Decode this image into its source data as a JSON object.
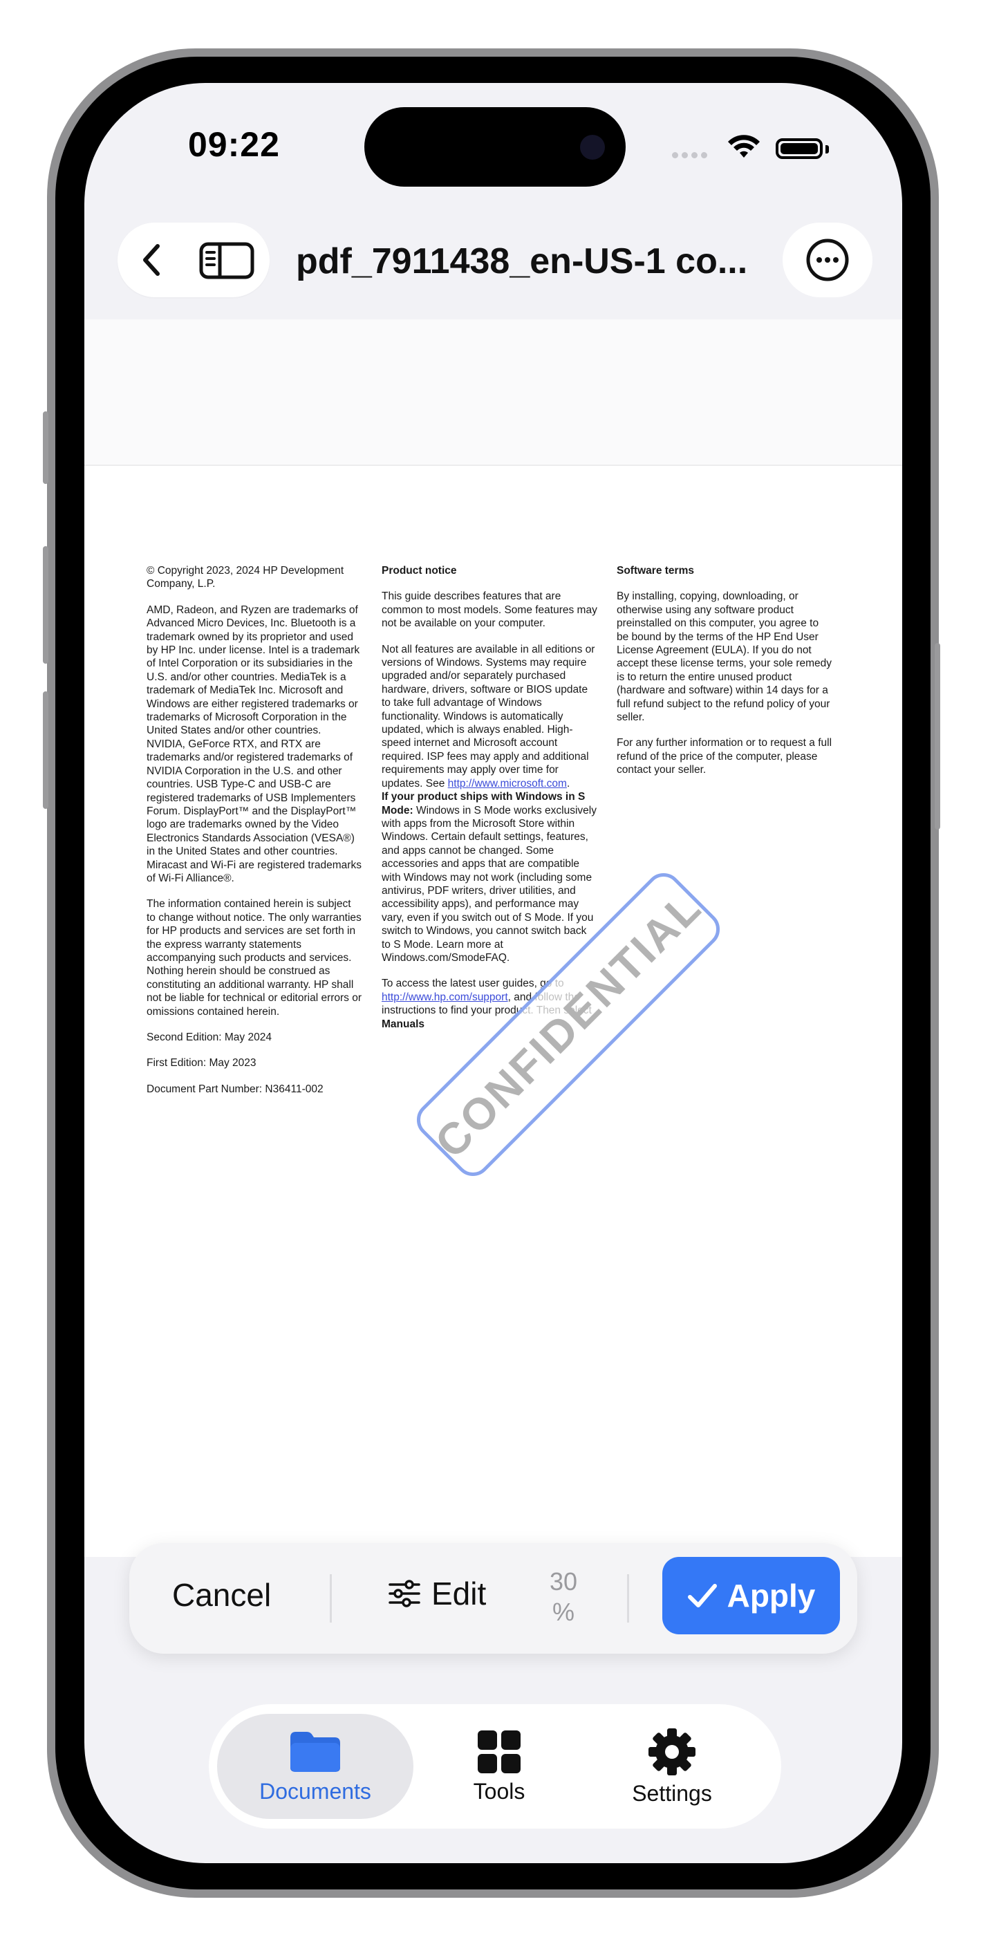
{
  "status": {
    "time": "09:22"
  },
  "nav": {
    "title": "pdf_7911438_en-US-1 co..."
  },
  "doc": {
    "col1": [
      "© Copyright 2023, 2024 HP Development Company, L.P.",
      "AMD, Radeon, and Ryzen are trademarks of Advanced Micro Devices, Inc. Bluetooth is a trademark owned by its proprietor and used by HP Inc. under license. Intel is a trademark of Intel Corporation or its subsidiaries in the U.S. and/or other countries. MediaTek is a trademark of MediaTek Inc. Microsoft and Windows are either registered trademarks or trademarks of Microsoft Corporation in the United States and/or other countries. NVIDIA, GeForce RTX, and RTX are trademarks and/or registered trademarks of NVIDIA Corporation in the U.S. and other countries. USB Type-C and USB-C are registered trademarks of USB Implementers Forum. DisplayPort™ and the DisplayPort™ logo are trademarks owned by the Video Electronics Standards Association (VESA®) in the United States and other countries. Miracast and Wi-Fi are registered trademarks of Wi-Fi Alliance®.",
      "The information contained herein is subject to change without notice. The only warranties for HP products and services are set forth in the express warranty statements accompanying such products and services. Nothing herein should be construed as constituting an additional warranty. HP shall not be liable for technical or editorial errors or omissions contained herein.",
      "Second Edition: May 2024",
      "First Edition: May 2023",
      "Document Part Number: N36411-002"
    ],
    "col2_heading": "Product notice",
    "col2_p1": "This guide describes features that are common to most models. Some features may not be available on your computer.",
    "col2_p2": "Not all features are available in all editions or versions of Windows. Systems may require upgraded and/or separately purchased hardware, drivers, software or BIOS update to take full advantage of Windows functionality. Windows is automatically updated, which is always enabled. High-speed internet and Microsoft account required. ISP fees may apply and additional requirements may apply over time for updates. See ",
    "col2_link1": "http://www.microsoft.com",
    "col2_p3_bold": "If your product ships with Windows in S Mode:",
    "col2_p3": " Windows in S Mode works exclusively with apps from the Microsoft Store within Windows. Certain default settings, features, and apps cannot be changed. Some accessories and apps that are compatible with Windows may not work (including some antivirus, PDF writers, driver utilities, and accessibility apps), and performance may vary, even if you switch out of S Mode. If you switch to Windows, you cannot switch back to S Mode. Learn more at Windows.com/SmodeFAQ.",
    "col2_p4": "To access the latest user guides, go to ",
    "col2_link2": "http://www.hp.com/support",
    "col2_p4b": ", and follow the instructions to find your product. Then select ",
    "col2_p4_bold": "Manuals",
    "col3_heading": "Software terms",
    "col3_p1": "By installing, copying, downloading, or otherwise using any software product preinstalled on this computer, you agree to be bound by the terms of the HP End User License Agreement (EULA). If you do not accept these license terms, your sole remedy is to return the entire unused product (hardware and software) within 14 days for a full refund subject to the refund policy of your seller.",
    "col3_p2": "For any further information or to request a full refund of the price of the computer, please contact your seller.",
    "watermark": "CONFIDENTIAL"
  },
  "toolbar": {
    "cancel": "Cancel",
    "edit": "Edit",
    "opacity": "30 %",
    "apply": "Apply"
  },
  "tabs": {
    "documents": "Documents",
    "tools": "Tools",
    "settings": "Settings"
  },
  "colors": {
    "accent": "#3478f6",
    "watermark_border": "#8aa6ef"
  }
}
